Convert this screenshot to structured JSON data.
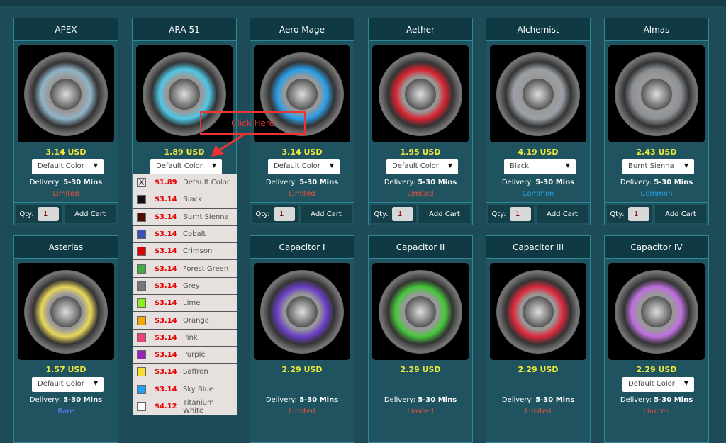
{
  "products": [
    {
      "name": "APEX",
      "price": "3.14  USD",
      "select": "Default Color",
      "delivery_label": "Delivery:",
      "delivery": "5-30 Mins",
      "rarity": "Limited",
      "rarity_color": "#e0533f",
      "qty_label": "Qty:",
      "qty": "1",
      "add_label": "Add Cart",
      "ring": "#8fb4c8"
    },
    {
      "name": "ARA-51",
      "price": "1.89  USD",
      "select": "Default Color",
      "delivery_label": "",
      "delivery": "",
      "rarity": "",
      "rarity_color": "#e0533f",
      "qty_label": "",
      "qty": "",
      "add_label": "",
      "ring": "#4fc7e6"
    },
    {
      "name": "Aero Mage",
      "price": "3.14  USD",
      "select": "Default Color",
      "delivery_label": "Delivery:",
      "delivery": "5-30 Mins",
      "rarity": "Limited",
      "rarity_color": "#e0533f",
      "qty_label": "Qty:",
      "qty": "1",
      "add_label": "Add Cart",
      "ring": "#2a9ee6"
    },
    {
      "name": "Aether",
      "price": "1.95  USD",
      "select": "Default Color",
      "delivery_label": "Delivery:",
      "delivery": "5-30 Mins",
      "rarity": "Limited",
      "rarity_color": "#e0533f",
      "qty_label": "Qty:",
      "qty": "1",
      "add_label": "Add Cart",
      "ring": "#d8232f"
    },
    {
      "name": "Alchemist",
      "price": "4.19  USD",
      "select": "Black",
      "delivery_label": "Delivery:",
      "delivery": "5-30 Mins",
      "rarity": "Common",
      "rarity_color": "#2aa0e0",
      "qty_label": "Qty:",
      "qty": "1",
      "add_label": "Add Cart",
      "ring": "#9aa0a6"
    },
    {
      "name": "Almas",
      "price": "2.43  USD",
      "select": "Burnt Sienna",
      "delivery_label": "Delivery:",
      "delivery": "5-30 Mins",
      "rarity": "Common",
      "rarity_color": "#2aa0e0",
      "qty_label": "Qty:",
      "qty": "1",
      "add_label": "Add Cart",
      "ring": "#8c9094"
    },
    {
      "name": "Asterias",
      "price": "1.57  USD",
      "select": "Default Color",
      "delivery_label": "Delivery:",
      "delivery": "5-30 Mins",
      "rarity": "Rare",
      "rarity_color": "#6b7cff",
      "qty_label": "",
      "qty": "",
      "add_label": "",
      "ring": "#e8d75a"
    },
    {
      "name": "",
      "price": "",
      "select": "",
      "delivery_label": "",
      "delivery": "",
      "rarity": "",
      "rarity_color": "",
      "qty_label": "",
      "qty": "",
      "add_label": "",
      "ring": ""
    },
    {
      "name": "Capacitor I",
      "price": "2.29  USD",
      "select": "",
      "delivery_label": "Delivery:",
      "delivery": "5-30 Mins",
      "rarity": "Limited",
      "rarity_color": "#e0533f",
      "qty_label": "",
      "qty": "",
      "add_label": "",
      "ring": "#6a3fc8"
    },
    {
      "name": "Capacitor II",
      "price": "2.29  USD",
      "select": "",
      "delivery_label": "Delivery:",
      "delivery": "5-30 Mins",
      "rarity": "Limited",
      "rarity_color": "#e0533f",
      "qty_label": "",
      "qty": "",
      "add_label": "",
      "ring": "#46c83a"
    },
    {
      "name": "Capacitor III",
      "price": "2.29  USD",
      "select": "",
      "delivery_label": "Delivery:",
      "delivery": "5-30 Mins",
      "rarity": "Limited",
      "rarity_color": "#e0533f",
      "qty_label": "",
      "qty": "",
      "add_label": "",
      "ring": "#e0283c"
    },
    {
      "name": "Capacitor IV",
      "price": "2.29  USD",
      "select": "Default Color",
      "delivery_label": "Delivery:",
      "delivery": "5-30 Mins",
      "rarity": "Limited",
      "rarity_color": "#e0533f",
      "qty_label": "",
      "qty": "",
      "add_label": "",
      "ring": "#c070e0"
    }
  ],
  "dropdown": [
    {
      "price": "$1.89",
      "name": "Default Color",
      "color": "",
      "mark": "X"
    },
    {
      "price": "$3.14",
      "name": "Black",
      "color": "#111111"
    },
    {
      "price": "$3.14",
      "name": "Burnt Sienna",
      "color": "#4a0f00"
    },
    {
      "price": "$3.14",
      "name": "Cobalt",
      "color": "#3d4fb5"
    },
    {
      "price": "$3.14",
      "name": "Crimson",
      "color": "#d90000"
    },
    {
      "price": "$3.14",
      "name": "Forest Green",
      "color": "#44aa44"
    },
    {
      "price": "$3.14",
      "name": "Grey",
      "color": "#777777"
    },
    {
      "price": "$3.14",
      "name": "Lime",
      "color": "#88ee22"
    },
    {
      "price": "$3.14",
      "name": "Orange",
      "color": "#f5a800"
    },
    {
      "price": "$3.14",
      "name": "Pink",
      "color": "#f0407a"
    },
    {
      "price": "$3.14",
      "name": "Purple",
      "color": "#9922bb"
    },
    {
      "price": "$3.14",
      "name": "Saffron",
      "color": "#f5e030"
    },
    {
      "price": "$3.14",
      "name": "Sky Blue",
      "color": "#20a0f0"
    },
    {
      "price": "$4.12",
      "name": "Titanium White",
      "color": "#ffffff"
    }
  ],
  "annotation": {
    "text": "Click Here",
    "color": "#e33333"
  }
}
